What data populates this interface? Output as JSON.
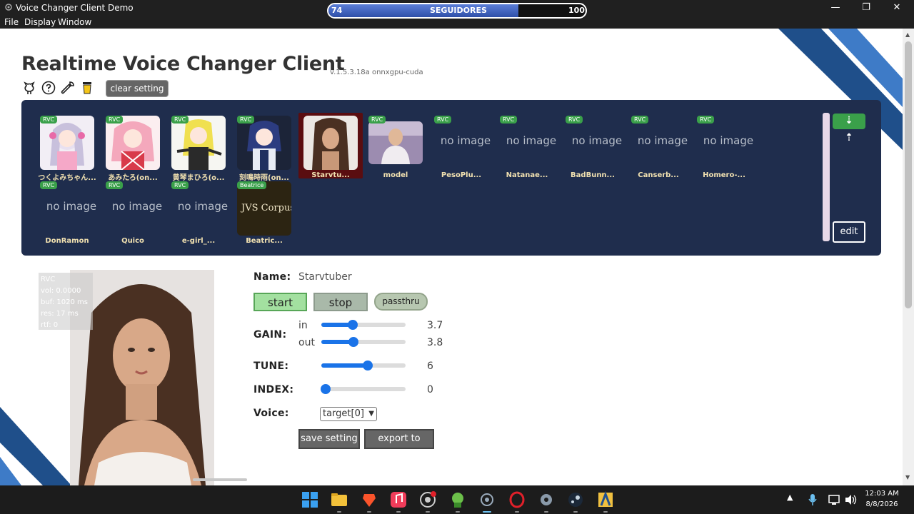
{
  "window": {
    "title": "Voice Changer Client Demo",
    "controls": {
      "minimize": "—",
      "restore": "❐",
      "close": "✕"
    }
  },
  "followers": {
    "current": "74",
    "label": "SEGUIDORES",
    "goal": "100",
    "progress": 0.74
  },
  "menu": {
    "items": [
      "File",
      "Display",
      "Window"
    ]
  },
  "header": {
    "title": "Realtime Voice Changer Client",
    "version": "v.1.5.3.18a  onnxgpu-cuda",
    "clear_button": "clear setting",
    "icons": [
      "github-icon",
      "help-icon",
      "wrench-icon",
      "coffee-icon"
    ]
  },
  "models": [
    {
      "label": "つくよみちゃん...",
      "badge": "RVC",
      "has_image": true
    },
    {
      "label": "あみたろ(on...",
      "badge": "RVC",
      "has_image": true
    },
    {
      "label": "黄琴まひろ(o...",
      "badge": "RVC",
      "has_image": true
    },
    {
      "label": "刻鳴時雨(on...",
      "badge": "RVC",
      "has_image": true
    },
    {
      "label": "Starvtu...",
      "badge": "",
      "has_image": true,
      "selected": true
    },
    {
      "label": "model",
      "badge": "RVC",
      "has_image": true
    },
    {
      "label": "PesoPlu...",
      "badge": "RVC",
      "has_image": false
    },
    {
      "label": "Natanae...",
      "badge": "RVC",
      "has_image": false
    },
    {
      "label": "BadBunn...",
      "badge": "RVC",
      "has_image": false
    },
    {
      "label": "Canserb...",
      "badge": "RVC",
      "has_image": false
    },
    {
      "label": "Homero-...",
      "badge": "RVC",
      "has_image": false
    },
    {
      "label": "DonRamon",
      "badge": "RVC",
      "has_image": false
    },
    {
      "label": "Quico",
      "badge": "RVC",
      "has_image": false
    },
    {
      "label": "e-girl_...",
      "badge": "RVC",
      "has_image": false
    },
    {
      "label": "Beatric...",
      "badge": "Beatrice",
      "has_image": true,
      "image_text": "JVS Corpus"
    }
  ],
  "no_image_text": "no image",
  "panel": {
    "edit_button": "edit",
    "sort_down": "⇣",
    "sort_up": "⇡"
  },
  "stats": {
    "type": "RVC",
    "vol": "vol: 0.0000",
    "buf": "buf: 1020 ms",
    "res": "res: 17 ms",
    "rtf": "rtf: 0"
  },
  "controls": {
    "name_label": "Name:",
    "name_value": "Starvtuber",
    "start": "start",
    "stop": "stop",
    "passthru": "passthru",
    "gain_label": "GAIN:",
    "in_label": "in",
    "out_label": "out",
    "gain_in": "3.7",
    "gain_out": "3.8",
    "gain_in_fraction": 0.37,
    "gain_out_fraction": 0.38,
    "tune_label": "TUNE:",
    "tune": "6",
    "tune_fraction": 0.55,
    "index_label": "INDEX:",
    "index": "0",
    "index_fraction": 0.05,
    "voice_label": "Voice:",
    "voice_value": "target[0]",
    "save_button": "save setting",
    "export_button": "export to onnx"
  },
  "taskbar": {
    "apps": [
      "windows-start-icon",
      "file-explorer-icon",
      "brave-icon",
      "music-icon",
      "chrome-icon",
      "character-icon",
      "voice-changer-icon",
      "opera-icon",
      "settings-icon",
      "steam-icon",
      "game-icon"
    ],
    "time": "12:03 AM",
    "date": "8/8/2026"
  },
  "colors": {
    "panel": "#1f2d4d",
    "accent": "#1a73e8",
    "badge": "#3aa04a",
    "stripe": "#1f4f8a"
  }
}
